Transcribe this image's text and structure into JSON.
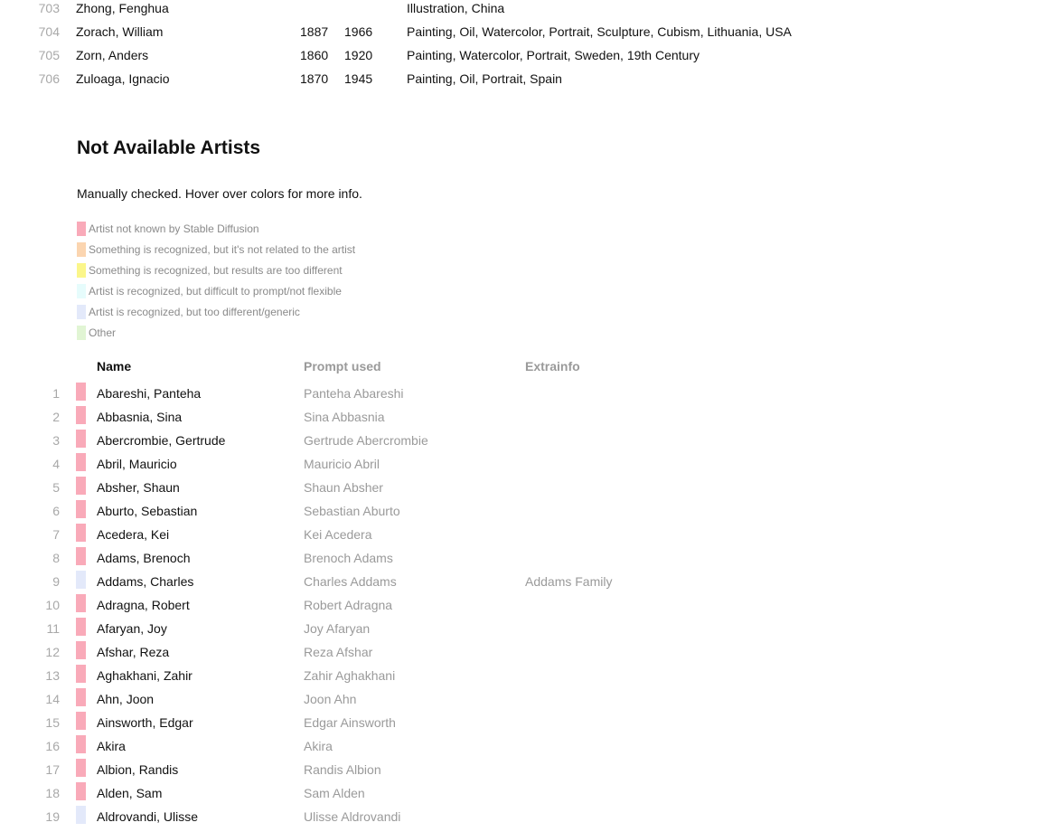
{
  "available_tail": [
    {
      "num": "703",
      "name": "Zhong, Fenghua",
      "born": "",
      "died": "",
      "tags": "Illustration, China"
    },
    {
      "num": "704",
      "name": "Zorach, William",
      "born": "1887",
      "died": "1966",
      "tags": "Painting, Oil, Watercolor, Portrait, Sculpture, Cubism, Lithuania, USA"
    },
    {
      "num": "705",
      "name": "Zorn, Anders",
      "born": "1860",
      "died": "1920",
      "tags": "Painting, Watercolor, Portrait, Sweden, 19th Century"
    },
    {
      "num": "706",
      "name": "Zuloaga, Ignacio",
      "born": "1870",
      "died": "1945",
      "tags": "Painting, Oil, Portrait, Spain"
    }
  ],
  "section": {
    "title": "Not Available Artists",
    "subtitle": "Manually checked. Hover over colors for more info."
  },
  "colors": {
    "not_known": "#f9aab9",
    "unrelated": "#fbd5b0",
    "too_different": "#fbf68a",
    "not_flexible": "#e6fcfc",
    "generic": "#e3e9fa",
    "other": "#e1f5d4"
  },
  "legend": [
    {
      "color_key": "not_known",
      "label": "Artist not known by Stable Diffusion"
    },
    {
      "color_key": "unrelated",
      "label": "Something is recognized, but it's not related to the artist"
    },
    {
      "color_key": "too_different",
      "label": "Something is recognized, but results are too different"
    },
    {
      "color_key": "not_flexible",
      "label": "Artist is recognized, but difficult to prompt/not flexible"
    },
    {
      "color_key": "generic",
      "label": "Artist is recognized, but too different/generic"
    },
    {
      "color_key": "other",
      "label": "Other"
    }
  ],
  "table": {
    "headers": {
      "name": "Name",
      "prompt": "Prompt used",
      "extra": "Extrainfo"
    },
    "rows": [
      {
        "num": "1",
        "status": "not_known",
        "name": "Abareshi, Panteha",
        "prompt": "Panteha Abareshi",
        "extra": ""
      },
      {
        "num": "2",
        "status": "not_known",
        "name": "Abbasnia, Sina",
        "prompt": "Sina Abbasnia",
        "extra": ""
      },
      {
        "num": "3",
        "status": "not_known",
        "name": "Abercrombie, Gertrude",
        "prompt": "Gertrude Abercrombie",
        "extra": ""
      },
      {
        "num": "4",
        "status": "not_known",
        "name": "Abril, Mauricio",
        "prompt": "Mauricio Abril",
        "extra": ""
      },
      {
        "num": "5",
        "status": "not_known",
        "name": "Absher, Shaun",
        "prompt": "Shaun Absher",
        "extra": ""
      },
      {
        "num": "6",
        "status": "not_known",
        "name": "Aburto, Sebastian",
        "prompt": "Sebastian Aburto",
        "extra": ""
      },
      {
        "num": "7",
        "status": "not_known",
        "name": "Acedera, Kei",
        "prompt": "Kei Acedera",
        "extra": ""
      },
      {
        "num": "8",
        "status": "not_known",
        "name": "Adams, Brenoch",
        "prompt": "Brenoch  Adams",
        "extra": ""
      },
      {
        "num": "9",
        "status": "generic",
        "name": "Addams, Charles",
        "prompt": "Charles Addams",
        "extra": "Addams Family"
      },
      {
        "num": "10",
        "status": "not_known",
        "name": "Adragna, Robert",
        "prompt": "Robert Adragna",
        "extra": ""
      },
      {
        "num": "11",
        "status": "not_known",
        "name": "Afaryan, Joy",
        "prompt": "Joy Afaryan",
        "extra": ""
      },
      {
        "num": "12",
        "status": "not_known",
        "name": "Afshar, Reza",
        "prompt": "Reza Afshar",
        "extra": ""
      },
      {
        "num": "13",
        "status": "not_known",
        "name": "Aghakhani, Zahir",
        "prompt": "Zahir Aghakhani",
        "extra": ""
      },
      {
        "num": "14",
        "status": "not_known",
        "name": "Ahn, Joon",
        "prompt": "Joon Ahn",
        "extra": ""
      },
      {
        "num": "15",
        "status": "not_known",
        "name": "Ainsworth, Edgar",
        "prompt": "Edgar Ainsworth",
        "extra": ""
      },
      {
        "num": "16",
        "status": "not_known",
        "name": "Akira",
        "prompt": "Akira",
        "extra": ""
      },
      {
        "num": "17",
        "status": "not_known",
        "name": "Albion, Randis",
        "prompt": "Randis Albion",
        "extra": ""
      },
      {
        "num": "18",
        "status": "not_known",
        "name": "Alden, Sam",
        "prompt": "Sam Alden",
        "extra": ""
      },
      {
        "num": "19",
        "status": "generic",
        "name": "Aldrovandi, Ulisse",
        "prompt": "Ulisse Aldrovandi",
        "extra": ""
      }
    ]
  }
}
